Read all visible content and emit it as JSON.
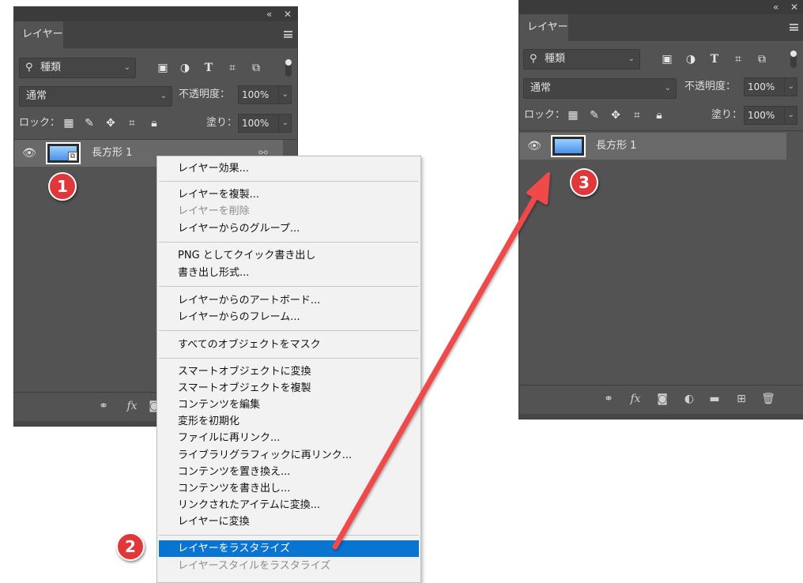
{
  "panel_left": {
    "collapse_icon": "«",
    "close_icon": "✕",
    "tab_label": "レイヤー",
    "filter_label": "種類",
    "blend_mode": "通常",
    "opacity_label": "不透明度：",
    "opacity_value": "100%",
    "lock_label": "ロック：",
    "fill_label": "塗り：",
    "fill_value": "100%",
    "layer_name": "長方形 1",
    "footer_icons": [
      "link-icon",
      "fx-icon",
      "mask-icon"
    ]
  },
  "panel_right": {
    "collapse_icon": "«",
    "close_icon": "✕",
    "tab_label": "レイヤー",
    "filter_label": "種類",
    "blend_mode": "通常",
    "opacity_label": "不透明度：",
    "opacity_value": "100%",
    "lock_label": "ロック：",
    "fill_label": "塗り：",
    "fill_value": "100%",
    "layer_name": "長方形 1",
    "footer_icons": [
      "link-icon",
      "fx-icon",
      "mask-icon",
      "adjustment-icon",
      "folder-icon",
      "new-layer-icon",
      "trash-icon"
    ]
  },
  "context_menu": {
    "items": [
      {
        "label": "レイヤー効果...",
        "disabled": false
      },
      {
        "label": "レイヤーを複製...",
        "disabled": false
      },
      {
        "label": "レイヤーを削除",
        "disabled": true
      },
      {
        "label": "レイヤーからのグループ...",
        "disabled": false
      },
      {
        "label": "PNG としてクイック書き出し",
        "disabled": false
      },
      {
        "label": "書き出し形式...",
        "disabled": false
      },
      {
        "label": "レイヤーからのアートボード...",
        "disabled": false
      },
      {
        "label": "レイヤーからのフレーム...",
        "disabled": false
      },
      {
        "label": "すべてのオブジェクトをマスク",
        "disabled": false
      },
      {
        "label": "スマートオブジェクトに変換",
        "disabled": false
      },
      {
        "label": "スマートオブジェクトを複製",
        "disabled": false
      },
      {
        "label": "コンテンツを編集",
        "disabled": false
      },
      {
        "label": "変形を初期化",
        "disabled": false
      },
      {
        "label": "ファイルに再リンク...",
        "disabled": false
      },
      {
        "label": "ライブラリグラフィックに再リンク...",
        "disabled": false
      },
      {
        "label": "コンテンツを置き換え...",
        "disabled": false
      },
      {
        "label": "コンテンツを書き出し...",
        "disabled": false
      },
      {
        "label": "リンクされたアイテムに変換...",
        "disabled": false
      },
      {
        "label": "レイヤーに変換",
        "disabled": false
      },
      {
        "label": "レイヤーをラスタライズ",
        "disabled": false,
        "selected": true
      },
      {
        "label": "レイヤースタイルをラスタライズ",
        "disabled": true
      }
    ]
  },
  "badges": [
    "1",
    "2",
    "3"
  ],
  "colors": {
    "panel_bg": "#535353",
    "selected_layer": "#696969",
    "menu_highlight": "#0a75d1",
    "badge_red": "#e0373a",
    "arrow_red": "#f0484a"
  }
}
